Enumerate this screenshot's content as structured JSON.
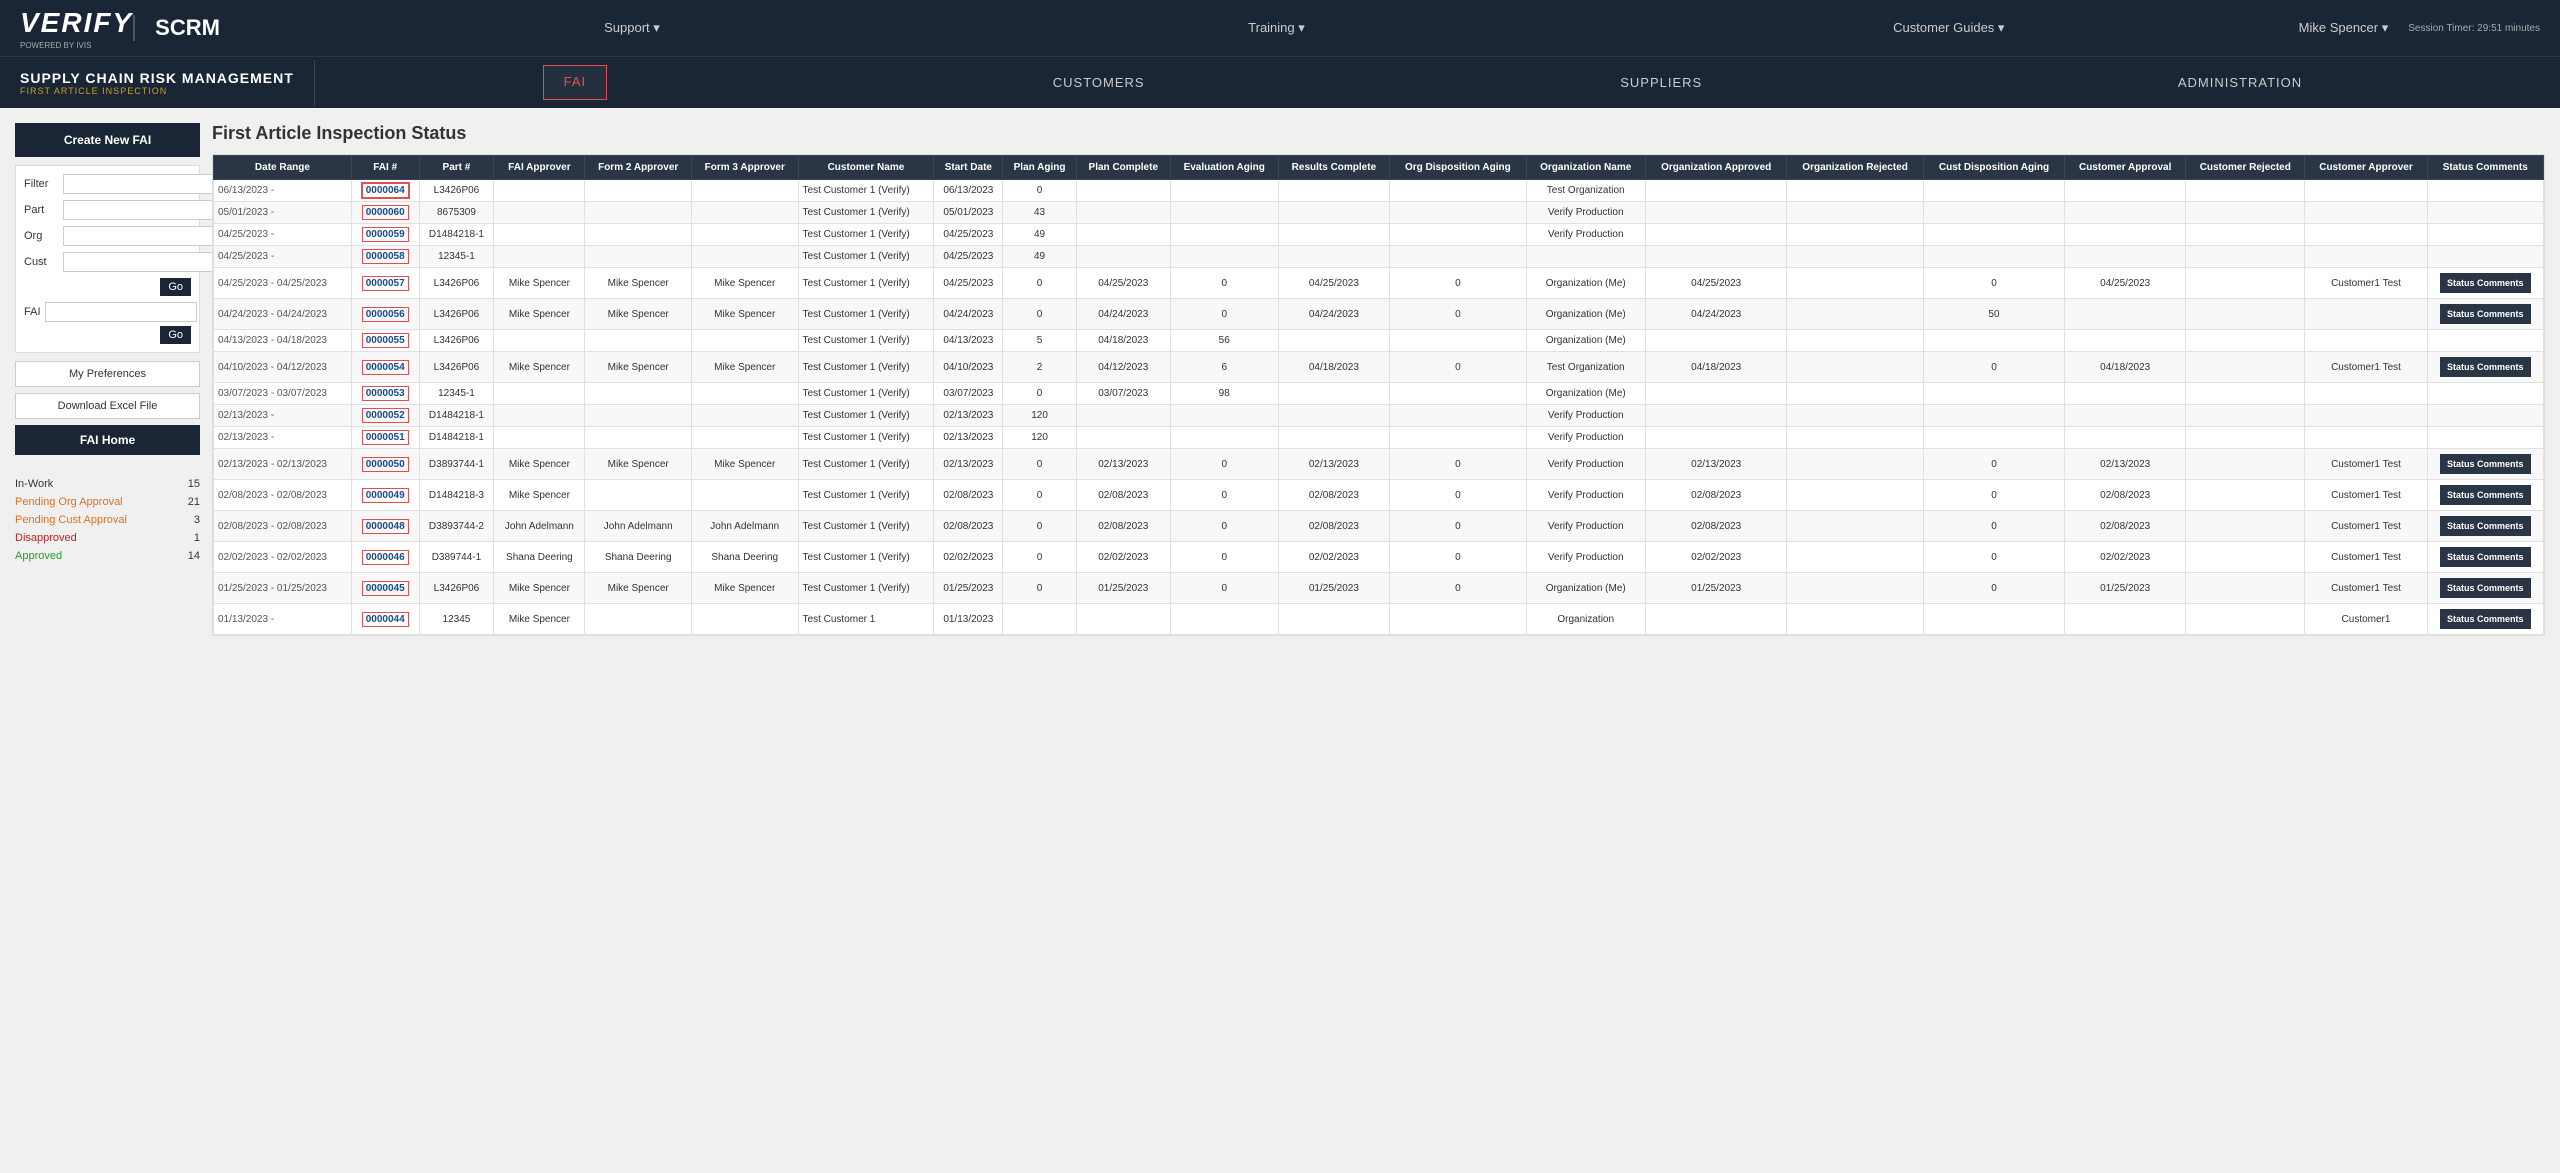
{
  "topNav": {
    "logo": "VERIFY",
    "logoPowered": "POWERED BY IVIS",
    "appName": "SCRM",
    "links": [
      {
        "label": "Support ▾"
      },
      {
        "label": "Training ▾"
      },
      {
        "label": "Customer Guides ▾"
      },
      {
        "label": "Mike Spencer ▾"
      }
    ],
    "session": "Session Timer: 29:51 minutes"
  },
  "secNav": {
    "appTitle": "SUPPLY CHAIN RISK MANAGEMENT",
    "appSubtitle": "FIRST ARTICLE INSPECTION",
    "tabs": [
      {
        "label": "FAI",
        "active": true,
        "outlined": true
      },
      {
        "label": "CUSTOMERS",
        "active": false
      },
      {
        "label": "SUPPLIERS",
        "active": false
      },
      {
        "label": "ADMINISTRATION",
        "active": false
      }
    ]
  },
  "pageTitle": "First Article Inspection Status",
  "sidebar": {
    "createBtn": "Create New FAI",
    "filters": {
      "filterLabel": "Filter",
      "partLabel": "Part",
      "orgLabel": "Org",
      "custLabel": "Cust",
      "faiLabel": "FAI",
      "goLabel": "Go"
    },
    "myPrefs": "My Preferences",
    "downloadExcel": "Download Excel File",
    "homeBtn": "FAI Home",
    "statusItems": [
      {
        "label": "In-Work",
        "count": "15",
        "color": "normal"
      },
      {
        "label": "Pending Org Approval",
        "count": "21",
        "color": "orange"
      },
      {
        "label": "Pending Cust Approval",
        "count": "3",
        "color": "orange"
      },
      {
        "label": "Disapproved",
        "count": "1",
        "color": "red"
      },
      {
        "label": "Approved",
        "count": "14",
        "color": "green"
      }
    ]
  },
  "tableHeaders": [
    "Date Range",
    "FAI #",
    "Part #",
    "FAI Approver",
    "Form 2 Approver",
    "Form 3 Approver",
    "Customer Name",
    "Start Date",
    "Plan Aging",
    "Plan Complete",
    "Evaluation Aging",
    "Results Complete",
    "Org Disposition Aging",
    "Organization Name",
    "Organization Approved",
    "Organization Rejected",
    "Cust Disposition Aging",
    "Customer Approval",
    "Customer Rejected",
    "Customer Approver",
    "Status Comments"
  ],
  "rows": [
    {
      "dateRange": "06/13/2023 -",
      "fai": "0000064",
      "part": "L3426P06",
      "faiApprover": "",
      "form2": "",
      "form3": "",
      "customer": "Test Customer 1 (Verify)",
      "startDate": "06/13/2023",
      "planAging": "0",
      "planComplete": "",
      "evalAging": "",
      "resultsComplete": "",
      "orgDispAging": "",
      "orgName": "Test Organization",
      "orgApproved": "",
      "orgRejected": "",
      "custDispAging": "",
      "custApproval": "",
      "custRejected": "",
      "custApprover": "",
      "hasStatus": false,
      "highlighted": true
    },
    {
      "dateRange": "05/01/2023 -",
      "fai": "0000060",
      "part": "8675309",
      "faiApprover": "",
      "form2": "",
      "form3": "",
      "customer": "Test Customer 1 (Verify)",
      "startDate": "05/01/2023",
      "planAging": "43",
      "planComplete": "",
      "evalAging": "",
      "resultsComplete": "",
      "orgDispAging": "",
      "orgName": "Verify Production",
      "orgApproved": "",
      "orgRejected": "",
      "custDispAging": "",
      "custApproval": "",
      "custRejected": "",
      "custApprover": "",
      "hasStatus": false
    },
    {
      "dateRange": "04/25/2023 -",
      "fai": "0000059",
      "part": "D1484218-1",
      "faiApprover": "",
      "form2": "",
      "form3": "",
      "customer": "Test Customer 1 (Verify)",
      "startDate": "04/25/2023",
      "planAging": "49",
      "planComplete": "",
      "evalAging": "",
      "resultsComplete": "",
      "orgDispAging": "",
      "orgName": "Verify Production",
      "orgApproved": "",
      "orgRejected": "",
      "custDispAging": "",
      "custApproval": "",
      "custRejected": "",
      "custApprover": "",
      "hasStatus": false
    },
    {
      "dateRange": "04/25/2023 -",
      "fai": "0000058",
      "part": "12345-1",
      "faiApprover": "",
      "form2": "",
      "form3": "",
      "customer": "Test Customer 1 (Verify)",
      "startDate": "04/25/2023",
      "planAging": "49",
      "planComplete": "",
      "evalAging": "",
      "resultsComplete": "",
      "orgDispAging": "",
      "orgName": "",
      "orgApproved": "",
      "orgRejected": "",
      "custDispAging": "",
      "custApproval": "",
      "custRejected": "",
      "custApprover": "",
      "hasStatus": false
    },
    {
      "dateRange": "04/25/2023 - 04/25/2023",
      "fai": "0000057",
      "part": "L3426P06",
      "faiApprover": "Mike Spencer",
      "form2": "Mike Spencer",
      "form3": "Mike Spencer",
      "customer": "Test Customer 1 (Verify)",
      "startDate": "04/25/2023",
      "planAging": "0",
      "planComplete": "04/25/2023",
      "evalAging": "0",
      "resultsComplete": "04/25/2023",
      "orgDispAging": "0",
      "orgName": "Organization (Me)",
      "orgApproved": "04/25/2023",
      "orgRejected": "",
      "custDispAging": "0",
      "custApproval": "04/25/2023",
      "custRejected": "",
      "custApprover": "Customer1 Test",
      "hasStatus": true
    },
    {
      "dateRange": "04/24/2023 - 04/24/2023",
      "fai": "0000056",
      "part": "L3426P06",
      "faiApprover": "Mike Spencer",
      "form2": "Mike Spencer",
      "form3": "Mike Spencer",
      "customer": "Test Customer 1 (Verify)",
      "startDate": "04/24/2023",
      "planAging": "0",
      "planComplete": "04/24/2023",
      "evalAging": "0",
      "resultsComplete": "04/24/2023",
      "orgDispAging": "0",
      "orgName": "Organization (Me)",
      "orgApproved": "04/24/2023",
      "orgRejected": "",
      "custDispAging": "50",
      "custApproval": "",
      "custRejected": "",
      "custApprover": "",
      "hasStatus": true
    },
    {
      "dateRange": "04/13/2023 - 04/18/2023",
      "fai": "0000055",
      "part": "L3426P06",
      "faiApprover": "",
      "form2": "",
      "form3": "",
      "customer": "Test Customer 1 (Verify)",
      "startDate": "04/13/2023",
      "planAging": "5",
      "planComplete": "04/18/2023",
      "evalAging": "56",
      "resultsComplete": "",
      "orgDispAging": "",
      "orgName": "Organization (Me)",
      "orgApproved": "",
      "orgRejected": "",
      "custDispAging": "",
      "custApproval": "",
      "custRejected": "",
      "custApprover": "",
      "hasStatus": false
    },
    {
      "dateRange": "04/10/2023 - 04/12/2023",
      "fai": "0000054",
      "part": "L3426P06",
      "faiApprover": "Mike Spencer",
      "form2": "Mike Spencer",
      "form3": "Mike Spencer",
      "customer": "Test Customer 1 (Verify)",
      "startDate": "04/10/2023",
      "planAging": "2",
      "planComplete": "04/12/2023",
      "evalAging": "6",
      "resultsComplete": "04/18/2023",
      "orgDispAging": "0",
      "orgName": "Test Organization",
      "orgApproved": "04/18/2023",
      "orgRejected": "",
      "custDispAging": "0",
      "custApproval": "04/18/2023",
      "custRejected": "",
      "custApprover": "Customer1 Test",
      "hasStatus": true
    },
    {
      "dateRange": "03/07/2023 - 03/07/2023",
      "fai": "0000053",
      "part": "12345-1",
      "faiApprover": "",
      "form2": "",
      "form3": "",
      "customer": "Test Customer 1 (Verify)",
      "startDate": "03/07/2023",
      "planAging": "0",
      "planComplete": "03/07/2023",
      "evalAging": "98",
      "resultsComplete": "",
      "orgDispAging": "",
      "orgName": "Organization (Me)",
      "orgApproved": "",
      "orgRejected": "",
      "custDispAging": "",
      "custApproval": "",
      "custRejected": "",
      "custApprover": "",
      "hasStatus": false
    },
    {
      "dateRange": "02/13/2023 -",
      "fai": "0000052",
      "part": "D1484218-1",
      "faiApprover": "",
      "form2": "",
      "form3": "",
      "customer": "Test Customer 1 (Verify)",
      "startDate": "02/13/2023",
      "planAging": "120",
      "planComplete": "",
      "evalAging": "",
      "resultsComplete": "",
      "orgDispAging": "",
      "orgName": "Verify Production",
      "orgApproved": "",
      "orgRejected": "",
      "custDispAging": "",
      "custApproval": "",
      "custRejected": "",
      "custApprover": "",
      "hasStatus": false
    },
    {
      "dateRange": "02/13/2023 -",
      "fai": "0000051",
      "part": "D1484218-1",
      "faiApprover": "",
      "form2": "",
      "form3": "",
      "customer": "Test Customer 1 (Verify)",
      "startDate": "02/13/2023",
      "planAging": "120",
      "planComplete": "",
      "evalAging": "",
      "resultsComplete": "",
      "orgDispAging": "",
      "orgName": "Verify Production",
      "orgApproved": "",
      "orgRejected": "",
      "custDispAging": "",
      "custApproval": "",
      "custRejected": "",
      "custApprover": "",
      "hasStatus": false
    },
    {
      "dateRange": "02/13/2023 - 02/13/2023",
      "fai": "0000050",
      "part": "D3893744-1",
      "faiApprover": "Mike Spencer",
      "form2": "Mike Spencer",
      "form3": "Mike Spencer",
      "customer": "Test Customer 1 (Verify)",
      "startDate": "02/13/2023",
      "planAging": "0",
      "planComplete": "02/13/2023",
      "evalAging": "0",
      "resultsComplete": "02/13/2023",
      "orgDispAging": "0",
      "orgName": "Verify Production",
      "orgApproved": "02/13/2023",
      "orgRejected": "",
      "custDispAging": "0",
      "custApproval": "02/13/2023",
      "custRejected": "",
      "custApprover": "Customer1 Test",
      "hasStatus": true
    },
    {
      "dateRange": "02/08/2023 - 02/08/2023",
      "fai": "0000049",
      "part": "D1484218-3",
      "faiApprover": "Mike Spencer",
      "form2": "",
      "form3": "",
      "customer": "Test Customer 1 (Verify)",
      "startDate": "02/08/2023",
      "planAging": "0",
      "planComplete": "02/08/2023",
      "evalAging": "0",
      "resultsComplete": "02/08/2023",
      "orgDispAging": "0",
      "orgName": "Verify Production",
      "orgApproved": "02/08/2023",
      "orgRejected": "",
      "custDispAging": "0",
      "custApproval": "02/08/2023",
      "custRejected": "",
      "custApprover": "Customer1 Test",
      "hasStatus": true
    },
    {
      "dateRange": "02/08/2023 - 02/08/2023",
      "fai": "0000048",
      "part": "D3893744-2",
      "faiApprover": "John Adelmann",
      "form2": "John Adelmann",
      "form3": "John Adelmann",
      "customer": "Test Customer 1 (Verify)",
      "startDate": "02/08/2023",
      "planAging": "0",
      "planComplete": "02/08/2023",
      "evalAging": "0",
      "resultsComplete": "02/08/2023",
      "orgDispAging": "0",
      "orgName": "Verify Production",
      "orgApproved": "02/08/2023",
      "orgRejected": "",
      "custDispAging": "0",
      "custApproval": "02/08/2023",
      "custRejected": "",
      "custApprover": "Customer1 Test",
      "hasStatus": true
    },
    {
      "dateRange": "02/02/2023 - 02/02/2023",
      "fai": "0000046",
      "part": "D389744-1",
      "faiApprover": "Shana Deering",
      "form2": "Shana Deering",
      "form3": "Shana Deering",
      "customer": "Test Customer 1 (Verify)",
      "startDate": "02/02/2023",
      "planAging": "0",
      "planComplete": "02/02/2023",
      "evalAging": "0",
      "resultsComplete": "02/02/2023",
      "orgDispAging": "0",
      "orgName": "Verify Production",
      "orgApproved": "02/02/2023",
      "orgRejected": "",
      "custDispAging": "0",
      "custApproval": "02/02/2023",
      "custRejected": "",
      "custApprover": "Customer1 Test",
      "hasStatus": true
    },
    {
      "dateRange": "01/25/2023 - 01/25/2023",
      "fai": "0000045",
      "part": "L3426P06",
      "faiApprover": "Mike Spencer",
      "form2": "Mike Spencer",
      "form3": "Mike Spencer",
      "customer": "Test Customer 1 (Verify)",
      "startDate": "01/25/2023",
      "planAging": "0",
      "planComplete": "01/25/2023",
      "evalAging": "0",
      "resultsComplete": "01/25/2023",
      "orgDispAging": "0",
      "orgName": "Organization (Me)",
      "orgApproved": "01/25/2023",
      "orgRejected": "",
      "custDispAging": "0",
      "custApproval": "01/25/2023",
      "custRejected": "",
      "custApprover": "Customer1 Test",
      "hasStatus": true
    },
    {
      "dateRange": "01/13/2023 -",
      "fai": "0000044",
      "part": "12345",
      "faiApprover": "Mike Spencer",
      "form2": "",
      "form3": "",
      "customer": "Test Customer 1",
      "startDate": "01/13/2023",
      "planAging": "",
      "planComplete": "",
      "evalAging": "",
      "resultsComplete": "",
      "orgDispAging": "",
      "orgName": "Organization",
      "orgApproved": "",
      "orgRejected": "",
      "custDispAging": "",
      "custApproval": "",
      "custRejected": "",
      "custApprover": "Customer1",
      "hasStatus": true
    }
  ]
}
